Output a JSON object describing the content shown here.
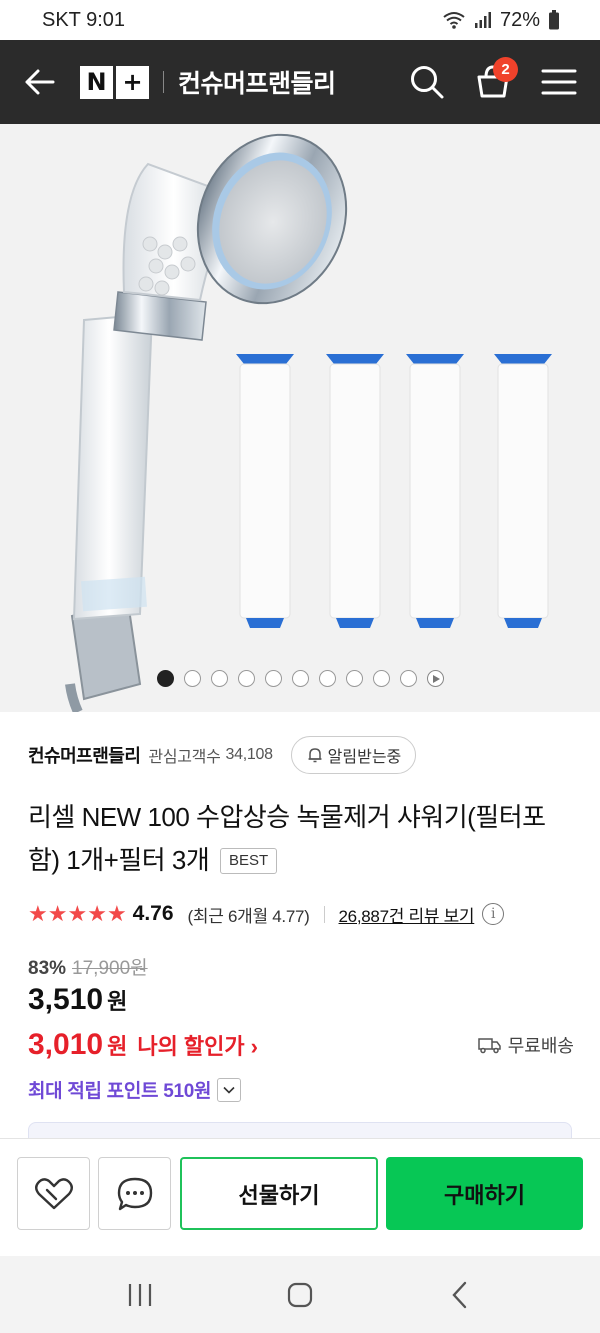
{
  "status_bar": {
    "carrier_time": "SKT 9:01",
    "battery": "72%"
  },
  "header": {
    "logo_n": "N",
    "logo_plus": "+",
    "store_name": "컨슈머프랜들리",
    "cart_count": "2"
  },
  "gallery": {
    "total_images": 10,
    "active_index": 0,
    "has_video": true
  },
  "store": {
    "name": "컨슈머프랜들리",
    "followers_label": "관심고객수",
    "followers_count": "34,108",
    "alarm_label": "알림받는중"
  },
  "product": {
    "title": "리셀 NEW 100 수압상승 녹물제거 샤워기(필터포함) 1개+필터 3개",
    "badge": "BEST",
    "rating": "4.76",
    "rating_stars": 4.76,
    "recent_rating": "(최근 6개월 4.77)",
    "review_link": "26,887건 리뷰 보기",
    "discount_rate": "83%",
    "original_price": "17,900원",
    "price": "3,510",
    "price_unit": "원",
    "my_price": "3,010",
    "my_price_unit": "원",
    "my_price_label": "나의 할인가",
    "shipping": "무료배송",
    "points": "최대 적립 포인트 510원"
  },
  "actions": {
    "gift": "선물하기",
    "buy": "구매하기"
  },
  "colors": {
    "header_bg": "#2b2b2b",
    "badge_red": "#f0422b",
    "sale_red": "#e6202a",
    "points_purple": "#6f49d6",
    "buy_green": "#07c755",
    "star_red": "#f24a4a"
  }
}
